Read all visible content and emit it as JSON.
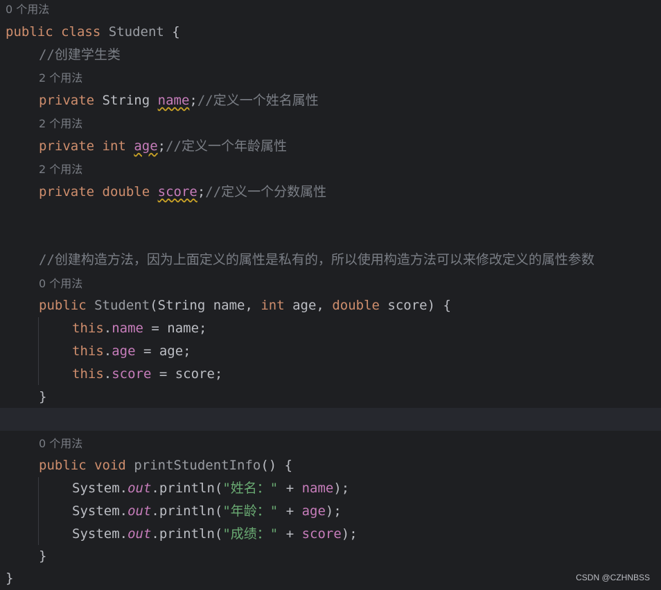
{
  "editor": {
    "hint_class_usage": "0 个用法",
    "class_line": {
      "kw1": "public",
      "kw2": "class",
      "name": "Student",
      "brace": "{"
    },
    "comment_class": "//创建学生类",
    "hint_name": "2 个用法",
    "field_name": {
      "kw": "private",
      "type": "String",
      "var": "name",
      "semi": ";",
      "comment": "//定义一个姓名属性"
    },
    "hint_age": "2 个用法",
    "field_age": {
      "kw": "private",
      "type": "int",
      "var": "age",
      "semi": ";",
      "comment": "//定义一个年龄属性"
    },
    "hint_score": "2 个用法",
    "field_score": {
      "kw": "private",
      "type": "double",
      "var": "score",
      "semi": ";",
      "comment": "//定义一个分数属性"
    },
    "comment_ctor": "//创建构造方法，因为上面定义的属性是私有的，所以使用构造方法可以来修改定义的属性参数",
    "hint_ctor": "0 个用法",
    "ctor_sig": {
      "kw": "public",
      "name": "Student",
      "open": "(",
      "t1": "String",
      "p1": " name, ",
      "t2": "int",
      "p2": " age, ",
      "t3": "double",
      "p3": " score) {"
    },
    "ctor_body": [
      {
        "this": "this",
        "dot": ".",
        "field": "name",
        "rest": " = name;"
      },
      {
        "this": "this",
        "dot": ".",
        "field": "age",
        "rest": " = age;"
      },
      {
        "this": "this",
        "dot": ".",
        "field": "score",
        "rest": " = score;"
      }
    ],
    "ctor_close": "}",
    "hint_method": "0 个用法",
    "method_sig": {
      "kw1": "public",
      "kw2": "void",
      "name": "printStudentInfo",
      "rest": "() {"
    },
    "method_body": [
      {
        "sys": "System.",
        "out": "out",
        "call": ".println(",
        "str": "\"姓名：\"",
        "plus": " + ",
        "field": "name",
        "end": ");"
      },
      {
        "sys": "System.",
        "out": "out",
        "call": ".println(",
        "str": "\"年龄：\"",
        "plus": " + ",
        "field": "age",
        "end": ");"
      },
      {
        "sys": "System.",
        "out": "out",
        "call": ".println(",
        "str": "\"成绩：\"",
        "plus": " + ",
        "field": "score",
        "end": ");"
      }
    ],
    "method_close": "}",
    "class_close": "}"
  },
  "watermark": "CSDN @CZHNBSS"
}
